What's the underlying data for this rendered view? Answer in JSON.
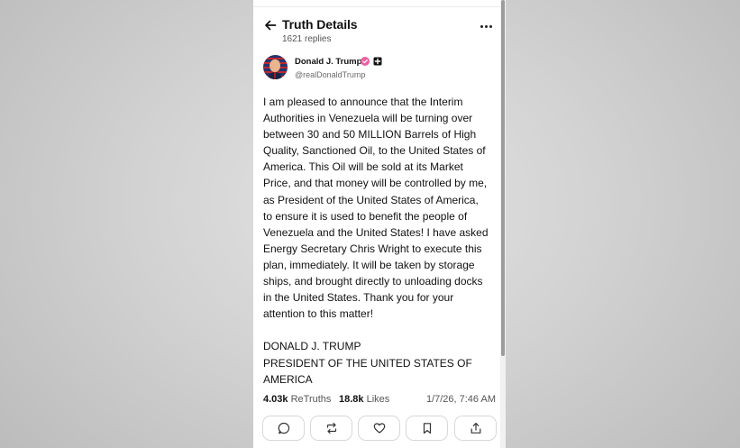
{
  "header": {
    "title": "Truth Details",
    "replies": "1621 replies"
  },
  "post": {
    "author": {
      "name": "Donald J. Trump",
      "handle": "@realDonaldTrump"
    },
    "body": "I am pleased to announce that the Interim\nAuthorities in Venezuela will be turning over\nbetween 30 and 50 MILLION Barrels of High\nQuality, Sanctioned Oil, to the United States of\nAmerica. This Oil will be sold at its Market\nPrice, and that money will be controlled by me,\nas President of the United States of America,\nto ensure it is used to benefit the people of\nVenezuela and the United States! I have asked\nEnergy Secretary Chris Wright to execute this\nplan, immediately. It will be taken by storage\nships, and brought directly to unloading docks\nin the United States. Thank you for your\nattention to this matter!\n\nDONALD J. TRUMP\nPRESIDENT OF THE UNITED STATES OF\nAMERICA",
    "stats": {
      "retruths_count": "4.03k",
      "retruths_label": "ReTruths",
      "likes_count": "18.8k",
      "likes_label": "Likes",
      "timestamp": "1/7/26, 7:46 AM"
    }
  },
  "actions": [
    {
      "icon": "reply-icon"
    },
    {
      "icon": "retruth-icon"
    },
    {
      "icon": "like-icon"
    },
    {
      "icon": "bookmark-icon"
    },
    {
      "icon": "share-icon"
    }
  ],
  "colors": {
    "verified": "#ec5fa0",
    "text": "#111111",
    "muted": "#555555",
    "border": "#d8d8d8",
    "backdrop": "#cfcfcf"
  }
}
